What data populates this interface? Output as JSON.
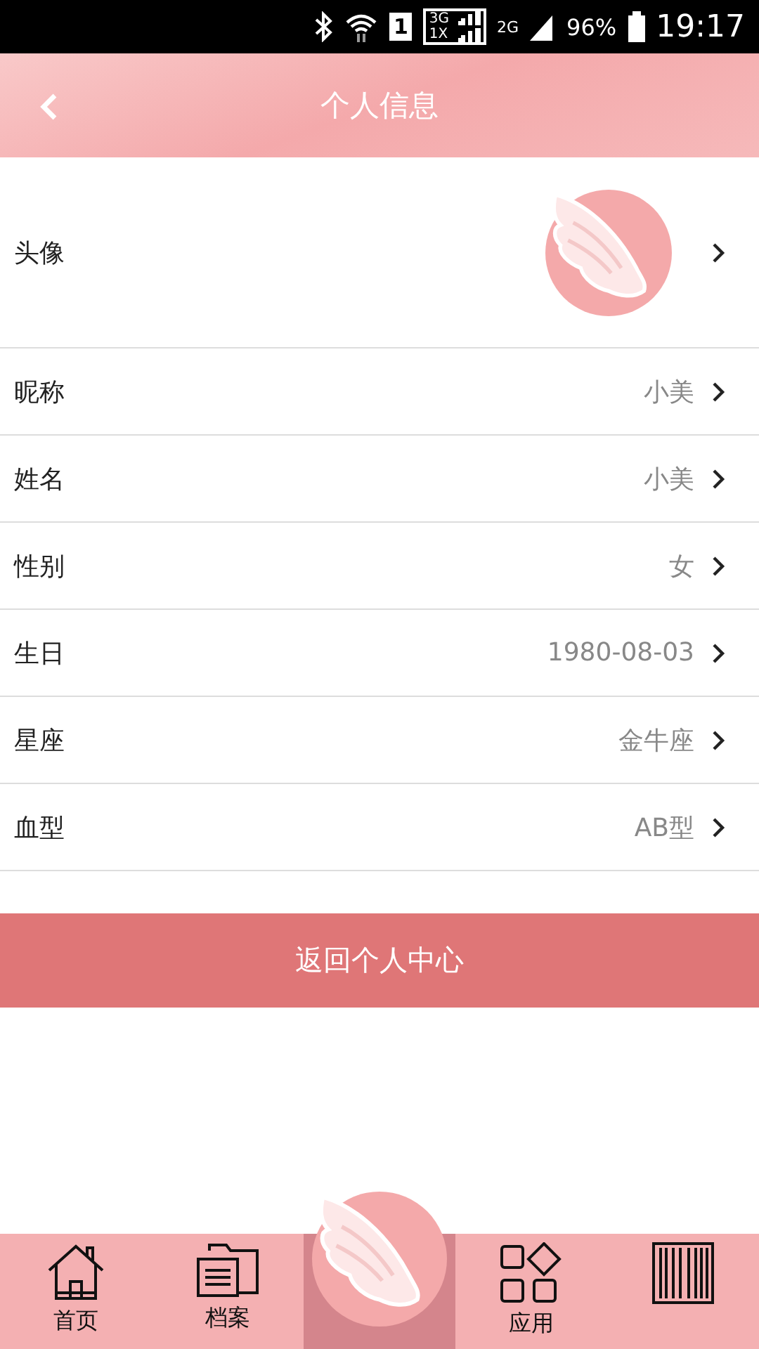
{
  "status_bar": {
    "sim": "1",
    "network_top": "3G",
    "network_bottom": "1X",
    "network_2": "2G",
    "battery": "96%",
    "time": "19:17"
  },
  "header": {
    "title": "个人信息"
  },
  "rows": [
    {
      "kind": "avatar",
      "label": "头像"
    },
    {
      "kind": "text",
      "label": "昵称",
      "value": "小美"
    },
    {
      "kind": "text",
      "label": "姓名",
      "value": "小美"
    },
    {
      "kind": "text",
      "label": "性别",
      "value": "女"
    },
    {
      "kind": "text",
      "label": "生日",
      "value": "1980-08-03"
    },
    {
      "kind": "text",
      "label": "星座",
      "value": "金牛座"
    },
    {
      "kind": "text",
      "label": "血型",
      "value": "AB型"
    }
  ],
  "action_button": "返回个人中心",
  "tabs": [
    {
      "kind": "home",
      "label": "首页",
      "selected": false
    },
    {
      "kind": "files",
      "label": "档案",
      "selected": false
    },
    {
      "kind": "logo",
      "selected": true
    },
    {
      "kind": "apps",
      "label": "应用",
      "selected": false
    },
    {
      "kind": "barcode",
      "selected": false
    }
  ]
}
